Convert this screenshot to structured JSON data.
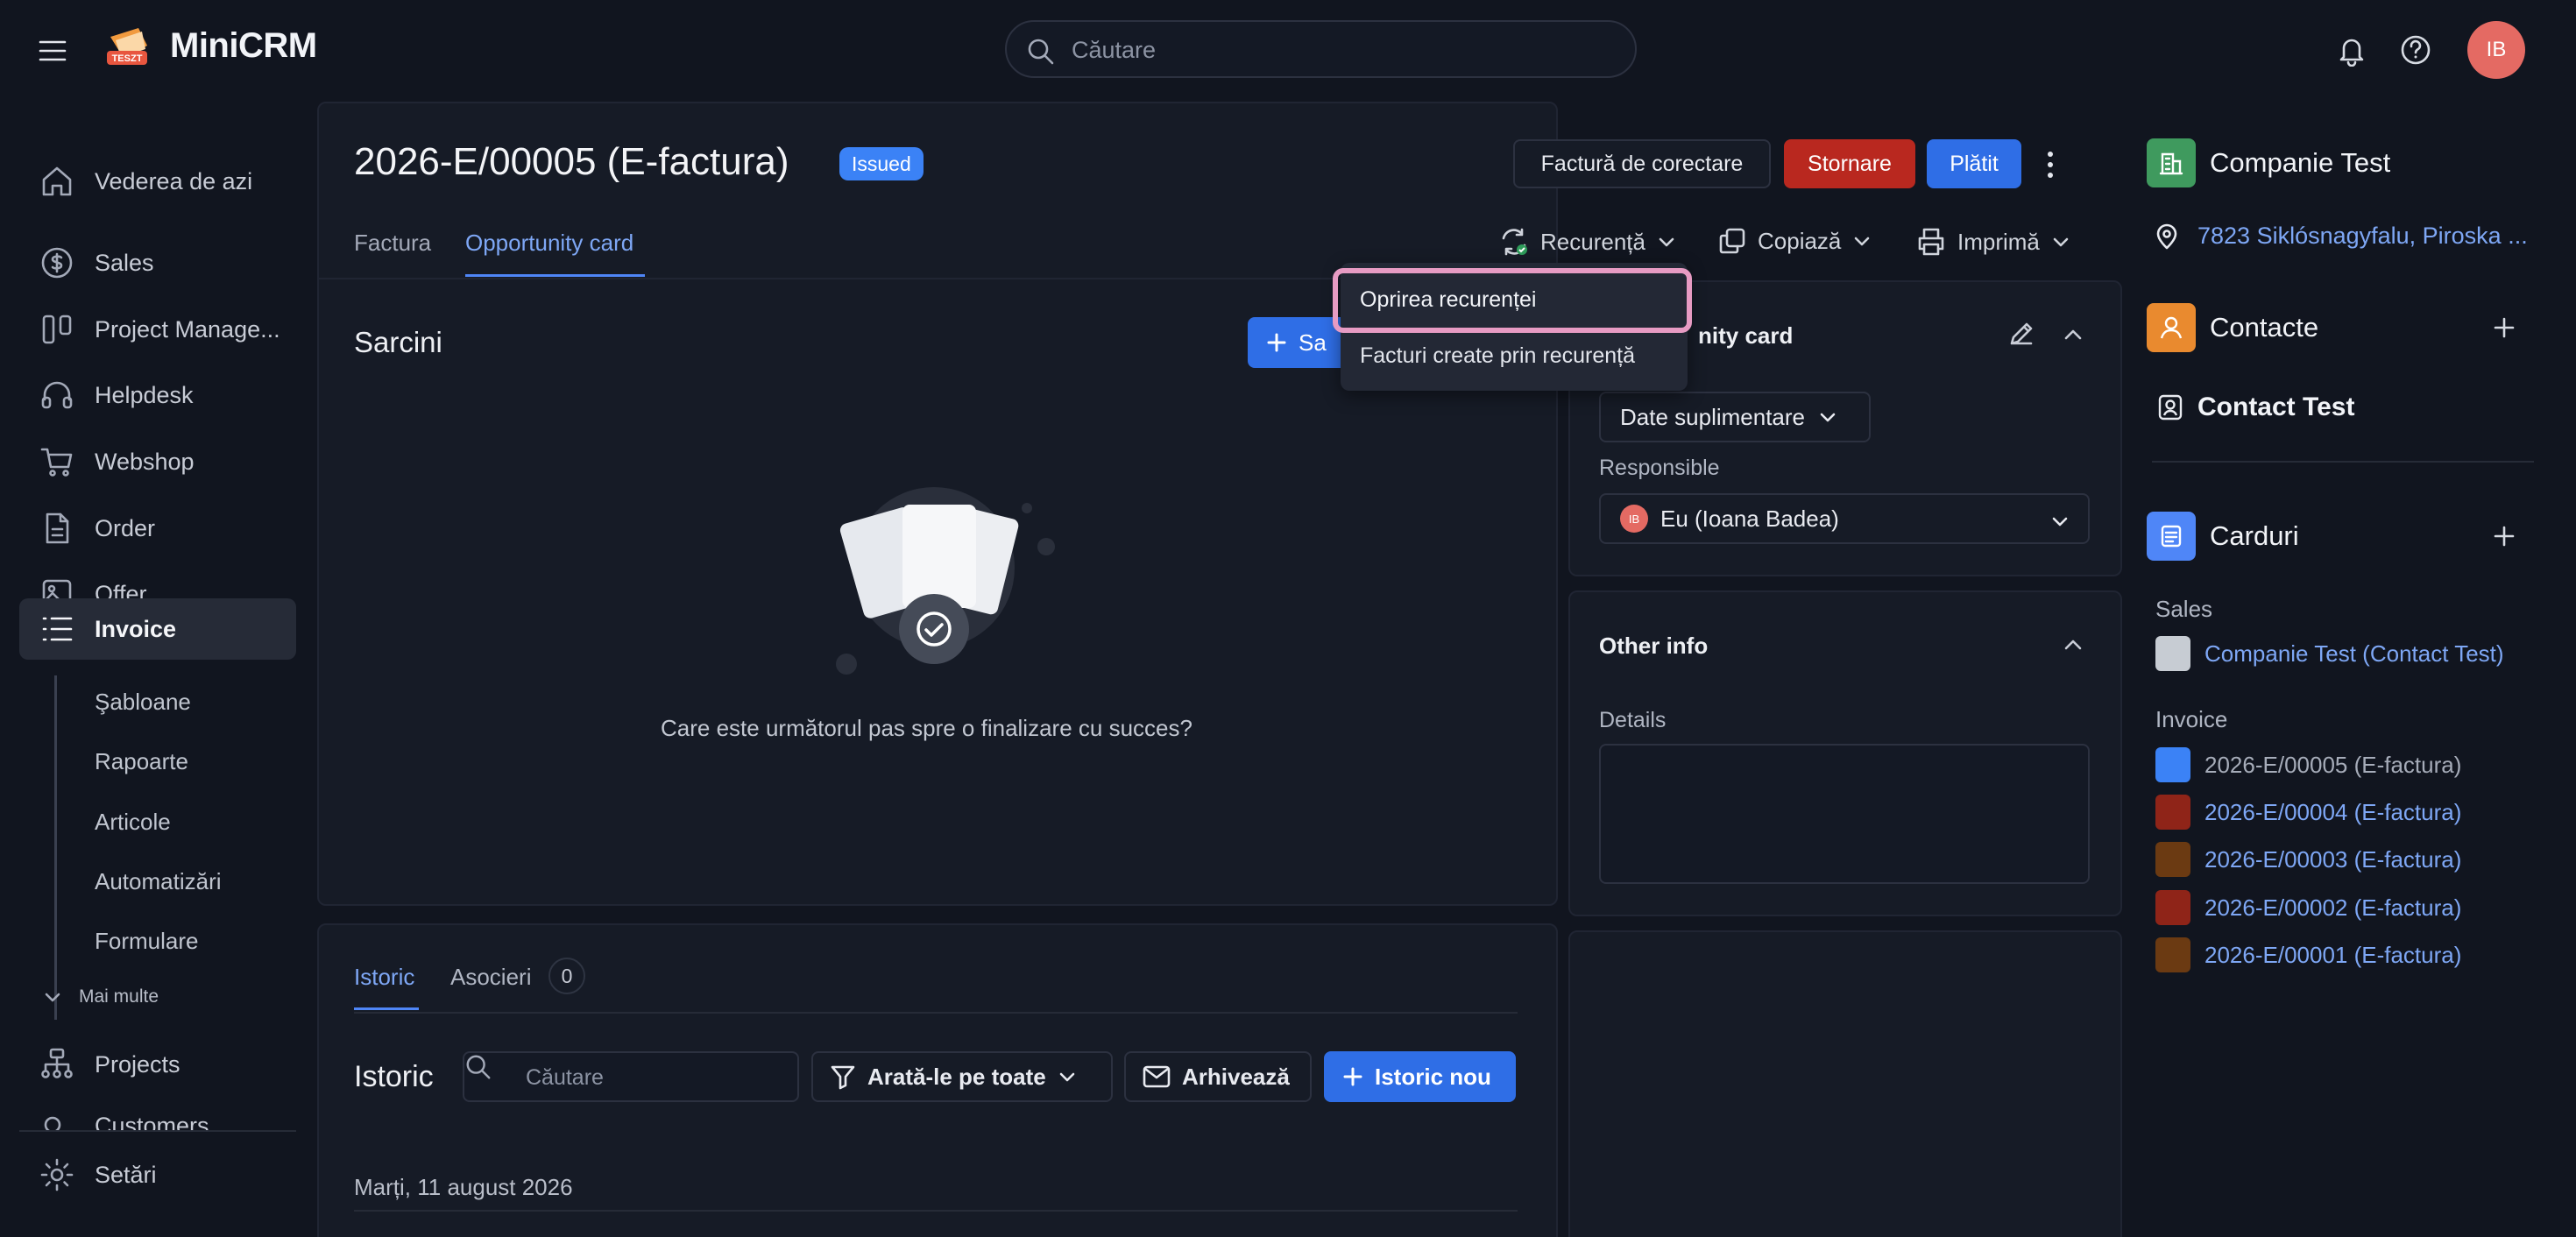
{
  "app": {
    "name": "MiniCRM",
    "logo_tag": "TESZT"
  },
  "header": {
    "search_placeholder": "Căutare",
    "avatar_initials": "IB"
  },
  "colors": {
    "primary": "#2f6ee6",
    "danger": "#b9281f",
    "accent_link": "#7ea7f5",
    "highlight": "#e79bc3"
  },
  "sidebar": {
    "items": [
      {
        "label": "Vederea de azi",
        "icon": "home-icon"
      },
      {
        "label": "Sales",
        "icon": "dollar-icon"
      },
      {
        "label": "Project Manage...",
        "icon": "kanban-icon"
      },
      {
        "label": "Helpdesk",
        "icon": "headset-icon"
      },
      {
        "label": "Webshop",
        "icon": "cart-icon"
      },
      {
        "label": "Order",
        "icon": "document-icon"
      },
      {
        "label": "Offer",
        "icon": "image-icon"
      },
      {
        "label": "Invoice",
        "icon": "list-icon",
        "active": true
      }
    ],
    "subitems": [
      "Şabloane",
      "Rapoarte",
      "Articole",
      "Automatizări",
      "Formulare"
    ],
    "more_label": "Mai multe",
    "items2": [
      {
        "label": "Projects",
        "icon": "sitemap-icon"
      },
      {
        "label": "Customers",
        "icon": "users-icon"
      }
    ],
    "settings_label": "Setări"
  },
  "invoice": {
    "title": "2026-E/00005 (E-factura)",
    "status": "Issued",
    "actions": {
      "correction": "Factură de corectare",
      "storno": "Stornare",
      "paid": "Plătit"
    },
    "tabs": [
      "Factura",
      "Opportunity card"
    ],
    "active_tab": "Opportunity card",
    "toolbar": {
      "recurrence": "Recurență",
      "copy": "Copiază",
      "print": "Imprimă"
    },
    "recurrence_menu": [
      "Oprirea recurenței",
      "Facturi create prin recurență"
    ]
  },
  "tasks": {
    "title": "Sarcini",
    "add_label": "Sa",
    "empty_text": "Care este următorul pas spre o finalizare cu succes?"
  },
  "history": {
    "tabs": [
      "Istoric",
      "Asocieri"
    ],
    "associations_count": "0",
    "title": "Istoric",
    "search_placeholder": "Căutare",
    "filter_label": "Arată-le pe toate",
    "archive_label": "Arhivează",
    "new_label": "Istoric nou",
    "date": "Marți, 11 august 2026"
  },
  "opportunity": {
    "title_visible": "nity card",
    "additional_label": "Date suplimentare",
    "responsible_label": "Responsible",
    "responsible_value": "Eu (Ioana Badea)",
    "responsible_initials": "IB",
    "other_info_title": "Other info",
    "details_label": "Details",
    "details_value": ""
  },
  "right": {
    "company": "Companie Test",
    "address": "7823 Siklósnagyfalu, Piroska ...",
    "contacts_title": "Contacte",
    "contact_name": "Contact Test",
    "cards_title": "Carduri",
    "groups": [
      {
        "name": "Sales",
        "cards": [
          {
            "label": "Companie Test (Contact Test)",
            "color": "#c7ccd3",
            "link": true
          }
        ]
      },
      {
        "name": "Invoice",
        "cards": [
          {
            "label": "2026-E/00005 (E-factura)",
            "color": "#3b82f6",
            "link": false
          },
          {
            "label": "2026-E/00004 (E-factura)",
            "color": "#8f2418",
            "link": true
          },
          {
            "label": "2026-E/00003 (E-factura)",
            "color": "#6b3a12",
            "link": true
          },
          {
            "label": "2026-E/00002 (E-factura)",
            "color": "#8f2418",
            "link": true
          },
          {
            "label": "2026-E/00001 (E-factura)",
            "color": "#6b3a12",
            "link": true
          }
        ]
      }
    ]
  }
}
